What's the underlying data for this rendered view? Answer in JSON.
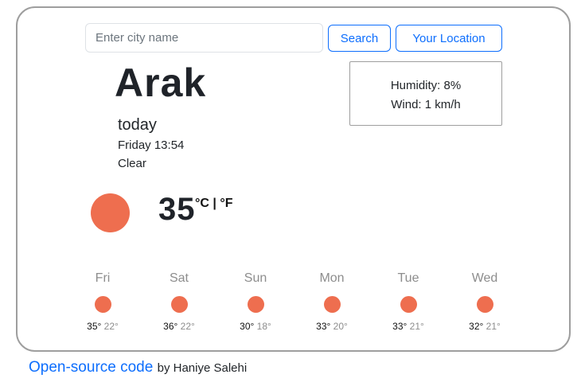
{
  "search": {
    "placeholder": "Enter city name",
    "value": "",
    "search_label": "Search",
    "location_label": "Your Location"
  },
  "current": {
    "city": "Arak",
    "day_label": "today",
    "datetime": "Friday 13:54",
    "condition": "Clear",
    "humidity": "Humidity: 8%",
    "wind": "Wind: 1 km/h",
    "temperature": "35",
    "unit_celsius": "°C",
    "unit_separator": " | ",
    "unit_fahrenheit": "°F",
    "icon": "sun-icon"
  },
  "forecast": [
    {
      "day": "Fri",
      "max": "35°",
      "min": "22°",
      "icon": "sun-icon"
    },
    {
      "day": "Sat",
      "max": "36°",
      "min": "22°",
      "icon": "sun-icon"
    },
    {
      "day": "Sun",
      "max": "30°",
      "min": "18°",
      "icon": "sun-icon"
    },
    {
      "day": "Mon",
      "max": "33°",
      "min": "20°",
      "icon": "sun-icon"
    },
    {
      "day": "Tue",
      "max": "33°",
      "min": "21°",
      "icon": "sun-icon"
    },
    {
      "day": "Wed",
      "max": "32°",
      "min": "21°",
      "icon": "sun-icon"
    }
  ],
  "footer": {
    "link_text": "Open-source code",
    "byline": "by Haniye Salehi"
  },
  "colors": {
    "accent": "#0d6efd",
    "sun": "#ee6e4f",
    "card_border": "#9e9e9e",
    "muted": "#8d8d8d"
  }
}
